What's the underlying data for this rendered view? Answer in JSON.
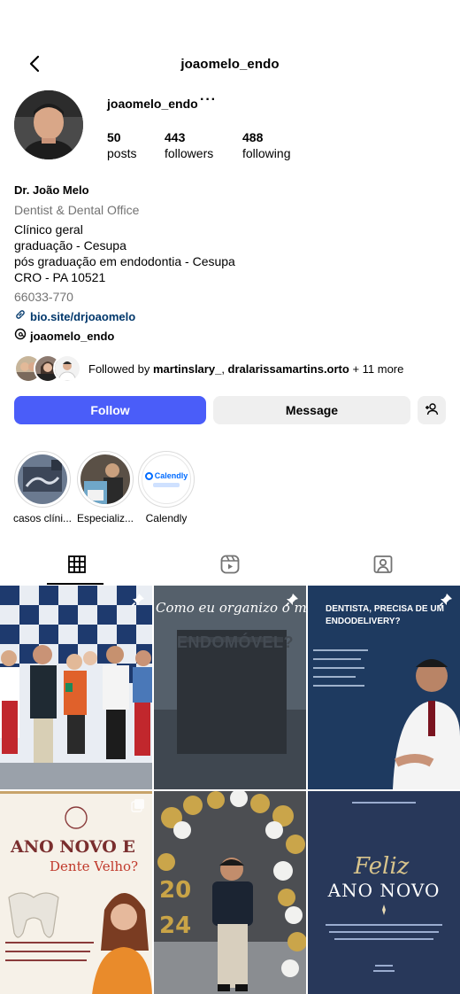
{
  "header": {
    "title": "joaomelo_endo"
  },
  "profile": {
    "username": "joaomelo_endo",
    "more": "···",
    "stats": {
      "posts_count": "50",
      "posts_label": "posts",
      "followers_count": "443",
      "followers_label": "followers",
      "following_count": "488",
      "following_label": "following"
    },
    "full_name": "Dr. João Melo",
    "category": "Dentist & Dental Office",
    "bio_lines": [
      "Clínico geral",
      "graduação - Cesupa",
      "pós graduação em endodontia - Cesupa",
      "CRO - PA 10521"
    ],
    "postal_code": "66033-770",
    "link": "bio.site/drjoaomelo",
    "threads": "joaomelo_endo"
  },
  "followed_by": {
    "prefix": "Followed by ",
    "name1": "martinslary_",
    "sep": ", ",
    "name2": "dralarissamartins.orto",
    "suffix": " + 11 more"
  },
  "actions": {
    "follow": "Follow",
    "message": "Message"
  },
  "highlights": [
    {
      "label": "casos clíni..."
    },
    {
      "label": "Especializ..."
    },
    {
      "label": "Calendly",
      "logo_text": "Calendly"
    }
  ],
  "posts": [
    {
      "type": "photo",
      "pinned": true
    },
    {
      "type": "text",
      "pinned": true,
      "headline": "Como eu organizo o meu",
      "overlay": "ENDOMÓVEL?"
    },
    {
      "type": "text",
      "pinned": true,
      "headline": "DENTISTA, PRECISA DE UM ENDODELIVERY?"
    },
    {
      "type": "text",
      "pinned": false,
      "headline": "ANO NOVO E",
      "subline": "Dente Velho?"
    },
    {
      "type": "photo",
      "pinned": false
    },
    {
      "type": "text",
      "pinned": false,
      "script": "Feliz",
      "headline": "ANO NOVO"
    }
  ],
  "colors": {
    "follow": "#4a5df9",
    "link": "#00376b",
    "muted": "#737373",
    "button_bg": "#efefef"
  }
}
